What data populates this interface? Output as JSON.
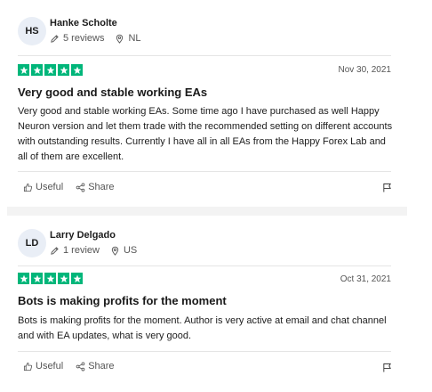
{
  "reviews": [
    {
      "avatar_initials": "HS",
      "author": "Hanke Scholte",
      "review_count": "5 reviews",
      "country": "NL",
      "rating": 5,
      "date": "Nov 30, 2021",
      "title": "Very good and stable working EAs",
      "body": "Very good and stable working EAs. Some time ago I have purchased as well Happy Neuron version and let them trade with the recommended setting on different accounts with outstanding results. Currently I have all in all EAs from the Happy Forex Lab and all of them are excellent.",
      "useful_label": "Useful",
      "share_label": "Share"
    },
    {
      "avatar_initials": "LD",
      "author": "Larry Delgado",
      "review_count": "1 review",
      "country": "US",
      "rating": 5,
      "date": "Oct 31, 2021",
      "title": "Bots is making profits for the moment",
      "body": "Bots is making profits for the moment. Author is very active at email and chat channel and with EA updates, what is very good.",
      "useful_label": "Useful",
      "share_label": "Share"
    }
  ],
  "colors": {
    "star_green": "#00b67a",
    "avatar_bg": "#e9eef6",
    "separator": "#f3f3f3"
  },
  "icons": [
    "pencil-icon",
    "location-pin-icon",
    "star-icon",
    "thumbs-up-icon",
    "share-icon",
    "flag-icon"
  ]
}
